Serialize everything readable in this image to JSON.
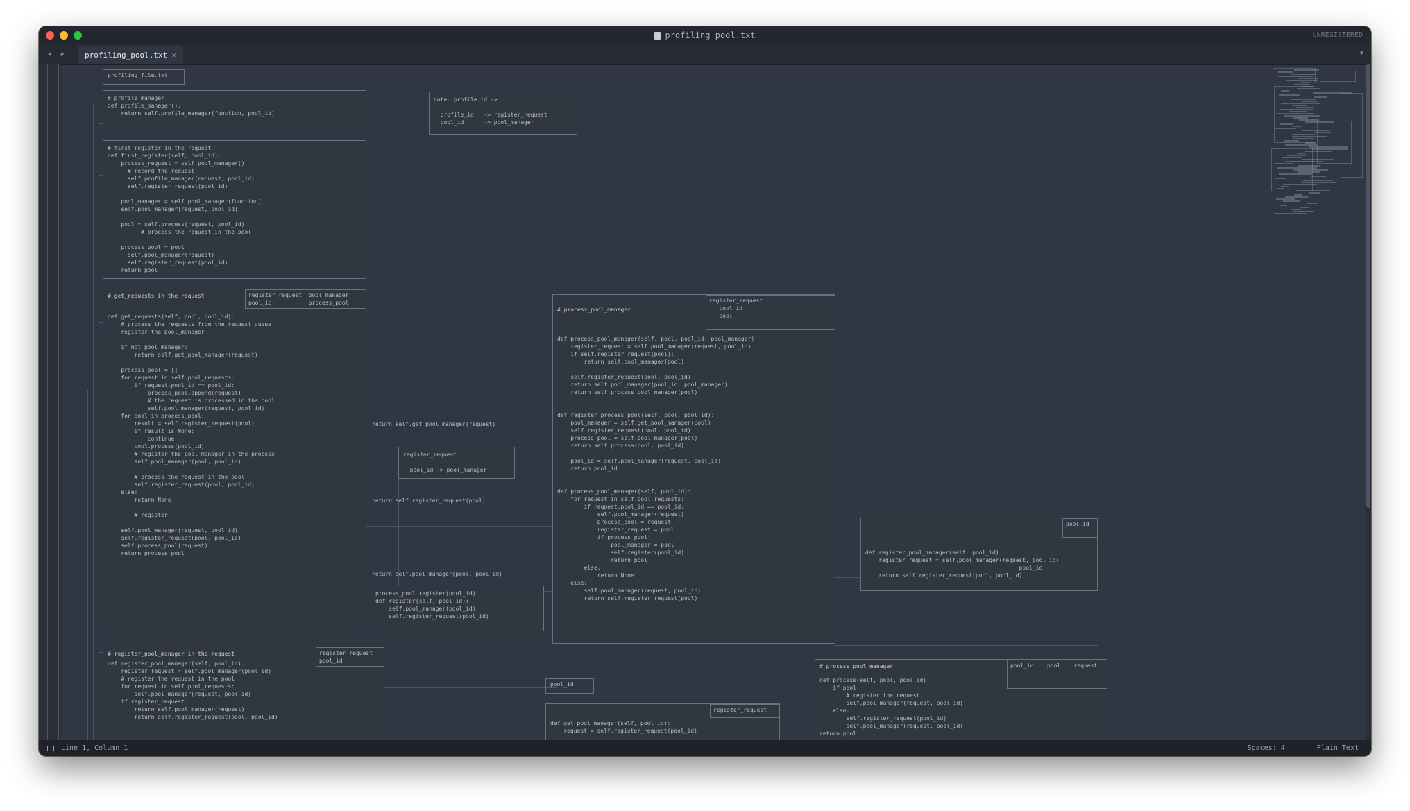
{
  "window": {
    "title": "profiling_pool.txt",
    "title_right": "UNREGISTERED",
    "tab_label": "profiling_pool.txt",
    "tab_close": "×",
    "nav_arrows": "◂ ▸",
    "tab_menu": "▾"
  },
  "editor": {
    "boxes": [
      {
        "id": "profiling-header",
        "text": "profiling_file.txt"
      },
      {
        "id": "code-block-1",
        "text": "# profile manager\ndef profile_manager():\n    return self.profile_manager(function, pool_id)"
      },
      {
        "id": "code-block-2",
        "text": "# first register in the request\ndef first_register(self, pool_id):\n    process_request = self.pool_manager()\n      # record the request\n      self.profile_manager(request, pool_id)\n      self.register_request(pool_id)\n\n    pool_manager = self.pool_manager(function)\n    self.pool_manager(request, pool_id)\n\n    pool = self.process(request, pool_id)\n          # process the request in the pool\n\n    process_pool = pool\n      self.pool_manager(request)\n      self.register_request(pool_id)\n    return pool"
      },
      {
        "id": "note-box-1",
        "text": "note: profile id ->\n\n  profile_id   -> register_request\n  pool_id      -> pool_manager"
      },
      {
        "id": "code-block-3-head",
        "text": "# get_requests in the request"
      },
      {
        "id": "code-block-3-inner",
        "text": "register_request  pool_manager\npool_id           process_pool"
      },
      {
        "id": "code-block-3",
        "text": "def get_requests(self, pool, pool_id):\n    # process the requests from the request queue\n    register the pool_manager\n\n    if not pool_manager:\n        return self.get_pool_manager(request)\n\n    process_pool = []\n    for request in self.pool_requests:\n        if request.pool_id == pool_id:\n            process_pool.append(request)\n            # the request is processed in the pool\n            self.pool_manager(request, pool_id)\n    for pool in process_pool:\n        result = self.register_request(pool)\n        if result is None:\n            continue\n        pool.process(pool_id)\n        # register the pool manager in the process\n        self.pool_manager(pool, pool_id)\n\n        # process the request in the pool\n        self.register_request(pool, pool_id)\n    else:\n        return None\n\n        # register\n\n    self.pool_manager(request, pool_id)\n    self.register_request(pool, pool_id)\n    self.process_pool(request)\n    return process_pool"
      },
      {
        "id": "mid-note-1",
        "text": "register_request\n\n  pool_id -> pool_manager"
      },
      {
        "id": "mid-note-2",
        "text": "process_pool.register(pool_id)\ndef register(self, pool_id):\n    self.pool_manager(pool_id)\n    self.register_request(pool_id)"
      },
      {
        "id": "arrow-label-1",
        "text": "return self.get_pool_manager(request)"
      },
      {
        "id": "arrow-label-2",
        "text": "return self.register_request(pool)"
      },
      {
        "id": "arrow-label-3",
        "text": "return self.pool_manager(pool, pool_id)"
      },
      {
        "id": "central-head",
        "text": "# process_pool_manager"
      },
      {
        "id": "central-inner",
        "text": "register_request\n   pool_id\n   pool"
      },
      {
        "id": "central-block",
        "text": "def process_pool_manager(self, pool, pool_id, pool_manager):\n    register_request = self.pool_manager(request, pool_id)\n    if self.register_request(pool):\n        return self.pool_manager(pool)\n\n    self.register_request(pool, pool_id)\n    return self.pool_manager(pool_id, pool_manager)\n    return self.process_pool_manager(pool)\n\n\ndef register_process_pool(self, pool, pool_id):\n    pool_manager = self.get_pool_manager(pool)\n    self.register_request(pool, pool_id)\n    process_pool = self.pool_manager(pool)\n    return self.process(pool, pool_id)\n\n    pool_id = self.pool_manager(request, pool_id)\n    return pool_id\n\n\ndef process_pool_manager(self, pool_id):\n    for request in self.pool_requests:\n        if request.pool_id == pool_id:\n            self.pool_manager(request)\n            process_pool = request\n            register_request = pool\n            if process_pool:\n                pool_manager = pool\n                self.register(pool_id)\n                return pool\n        else:\n            return None\n    else:\n        self.pool_manager(request, pool_id)\n        return self.register_request(pool)"
      },
      {
        "id": "right-box-head",
        "text": "pool_id"
      },
      {
        "id": "right-box",
        "text": "def register_pool_manager(self, pool_id):\n    register_request = self.pool_manager(request, pool_id)\n                                              pool_id\n    return self.register_request(pool, pool_id)"
      },
      {
        "id": "bottom-left-head",
        "text": "# register_pool_manager in the request"
      },
      {
        "id": "bottom-left-inner",
        "text": "register_request\npool_id"
      },
      {
        "id": "bottom-left-block",
        "text": "def register_pool_manager(self, pool_id):\n    register_request = self.pool_manager(pool_id)\n    # register the request in the pool\n    for request in self.pool_requests:\n        self.pool_manager(request, pool_id)\n    if register_request:\n        return self.pool_manager(request)\n        return self.register_request(pool, pool_id)"
      },
      {
        "id": "bottom-mid-label",
        "text": "pool_id"
      },
      {
        "id": "bottom-mid-head",
        "text": "register_request"
      },
      {
        "id": "bottom-mid-block",
        "text": "def get_pool_manager(self, pool_id):\n    request = self.register_request(pool_id)"
      },
      {
        "id": "bottom-right-head",
        "text": "# process_pool_manager"
      },
      {
        "id": "bottom-right-inner",
        "text": "pool_id    pool    request"
      },
      {
        "id": "bottom-right-block",
        "text": "def process(self, pool, pool_id):\n    if pool:\n        # register the request\n        self.pool_manager(request, pool_id)\n    else:\n        self.register_request(pool_id)\n        self.pool_manager(request, pool_id)\nreturn pool"
      }
    ]
  },
  "statusbar": {
    "position": "Line 1, Column 1",
    "spaces": "Spaces: 4",
    "syntax": "Plain Text"
  },
  "colors": {
    "background": "#313742",
    "titlebar": "#22262d",
    "text": "#b8bec8",
    "border": "#6a7280"
  }
}
